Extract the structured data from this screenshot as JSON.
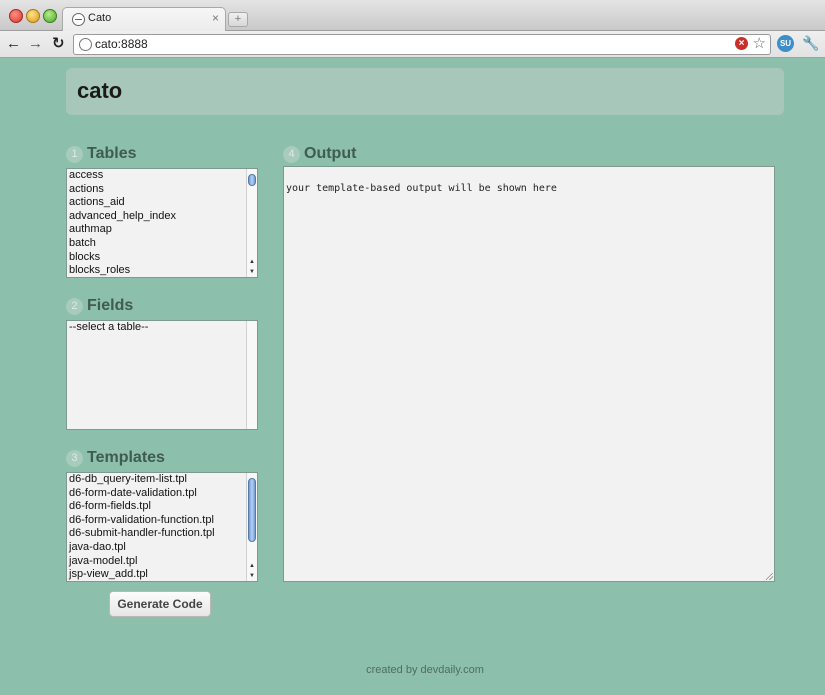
{
  "browser": {
    "tab_title": "Cato",
    "tab_close": "×",
    "new_tab": "+",
    "url": "cato:8888",
    "stop": "×",
    "star": "☆",
    "ext_label": "SU",
    "wrench": "🔧",
    "back": "←",
    "forward": "→",
    "reload": "↻"
  },
  "header": {
    "title": "cato"
  },
  "sections": {
    "tables": {
      "step": "1",
      "title": "Tables"
    },
    "fields": {
      "step": "2",
      "title": "Fields"
    },
    "templates": {
      "step": "3",
      "title": "Templates"
    },
    "output": {
      "step": "4",
      "title": "Output"
    }
  },
  "tables": [
    "access",
    "actions",
    "actions_aid",
    "advanced_help_index",
    "authmap",
    "batch",
    "blocks",
    "blocks_roles"
  ],
  "fields": [
    "--select a table--"
  ],
  "templates": [
    "d6-db_query-item-list.tpl",
    "d6-form-date-validation.tpl",
    "d6-form-fields.tpl",
    "d6-form-validation-function.tpl",
    "d6-submit-handler-function.tpl",
    "java-dao.tpl",
    "java-model.tpl",
    "jsp-view_add.tpl"
  ],
  "output": {
    "text": "your template-based output will be shown here"
  },
  "generate_button": "Generate Code",
  "footer": "created by devdaily.com",
  "colors": {
    "page_bg": "#8dbfad",
    "header_bg": "#a8c7bb",
    "section_title": "#3f5b52"
  }
}
